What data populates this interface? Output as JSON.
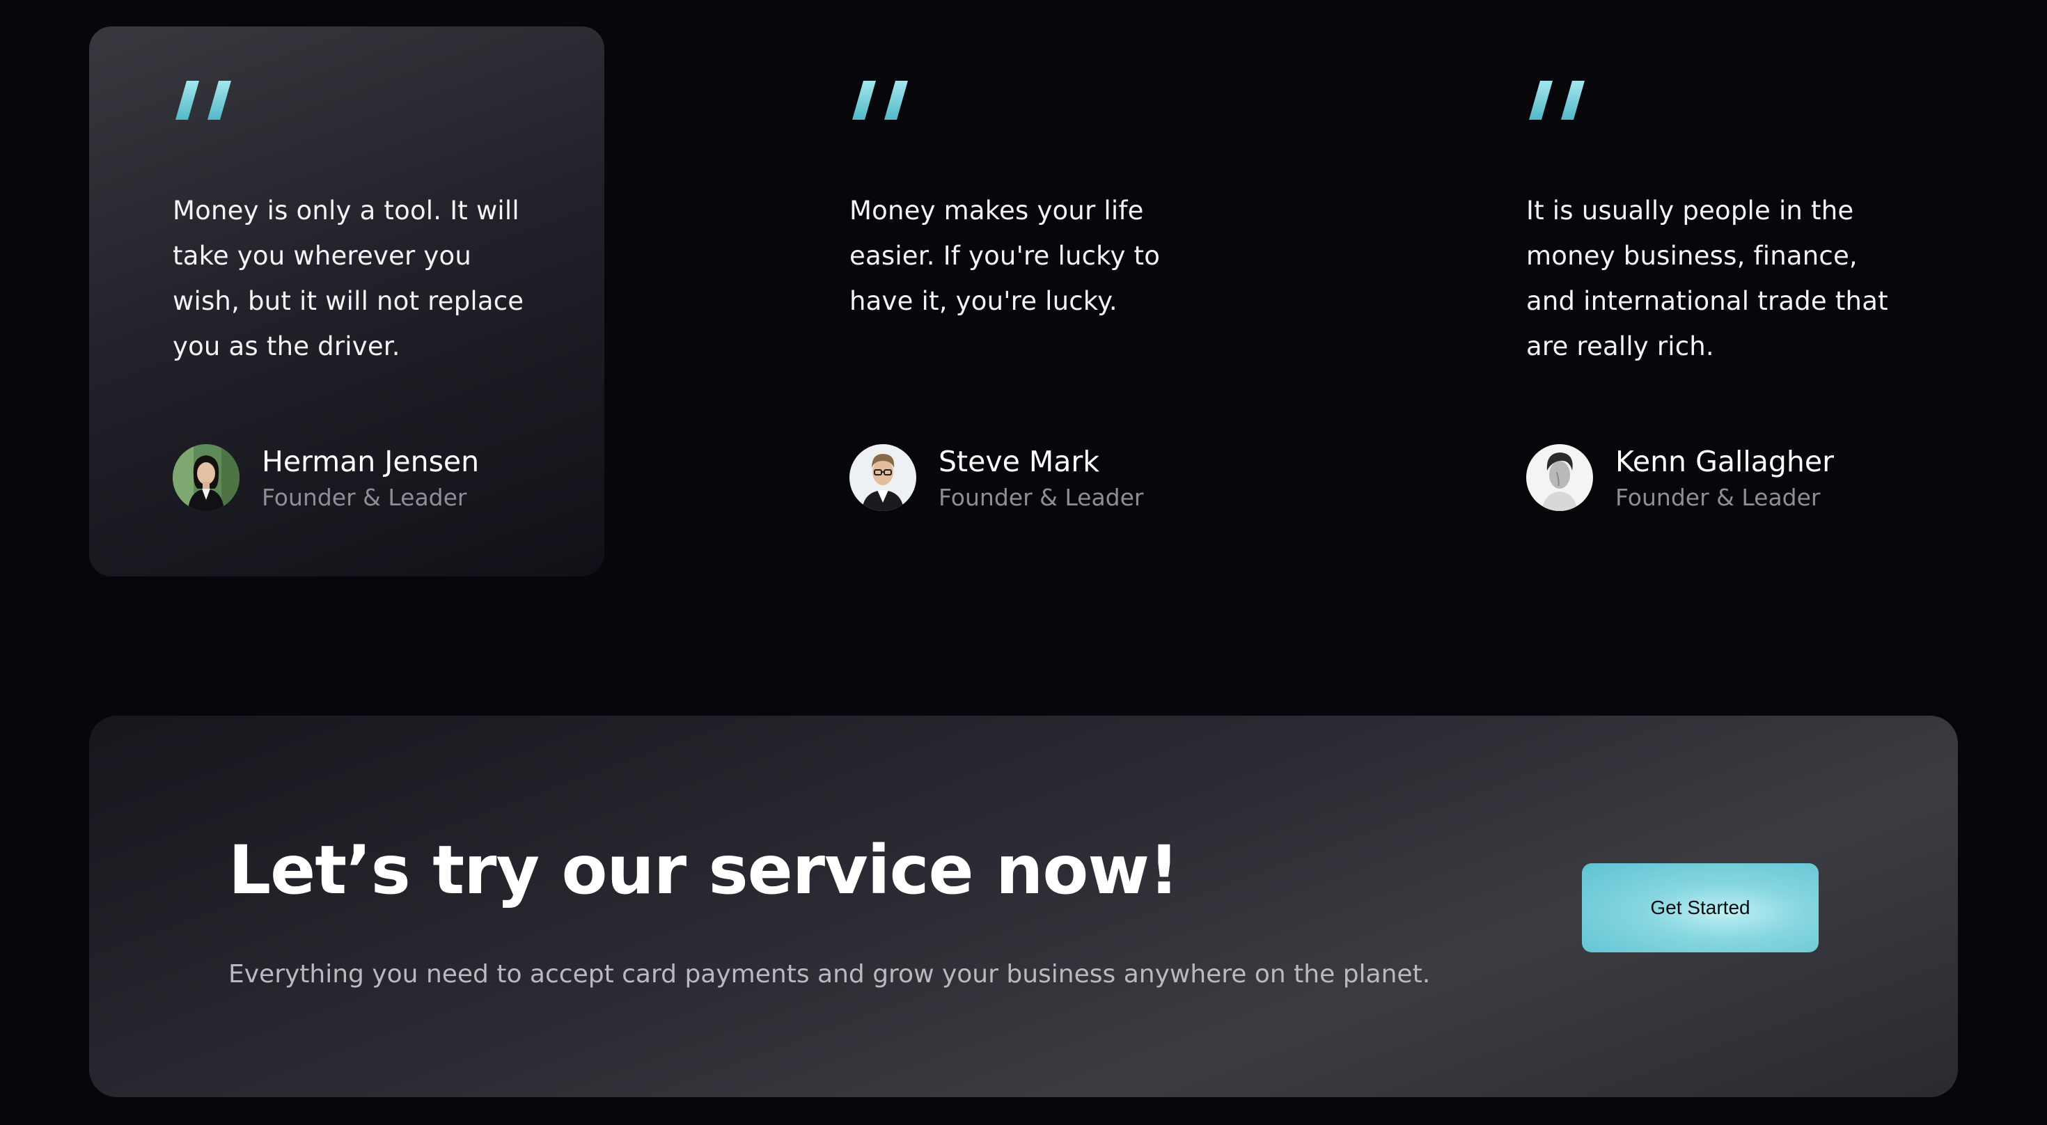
{
  "testimonials": [
    {
      "quote": "Money is only a tool. It will take you wherever you wish, but it will not replace you as the driver.",
      "name": "Herman Jensen",
      "role": "Founder & Leader",
      "avatar": "woman-portrait-avatar"
    },
    {
      "quote": "Money makes your life easier. If you're lucky to have it, you're lucky.",
      "name": "Steve Mark",
      "role": "Founder & Leader",
      "avatar": "man-with-glasses-avatar"
    },
    {
      "quote": "It is usually people in the money business, finance, and international trade that are really rich.",
      "name": "Kenn Gallagher",
      "role": "Founder & Leader",
      "avatar": "man-bw-portrait-avatar"
    }
  ],
  "cta": {
    "title": "Let’s try our service now!",
    "subtitle": "Everything you need to accept card payments and grow your business anywhere on the planet.",
    "button_label": "Get Started"
  },
  "colors": {
    "accent": "#7fd3de",
    "page_background": "#06060b",
    "card_background": "#2b2b33",
    "muted_text": "#8e8e96"
  }
}
